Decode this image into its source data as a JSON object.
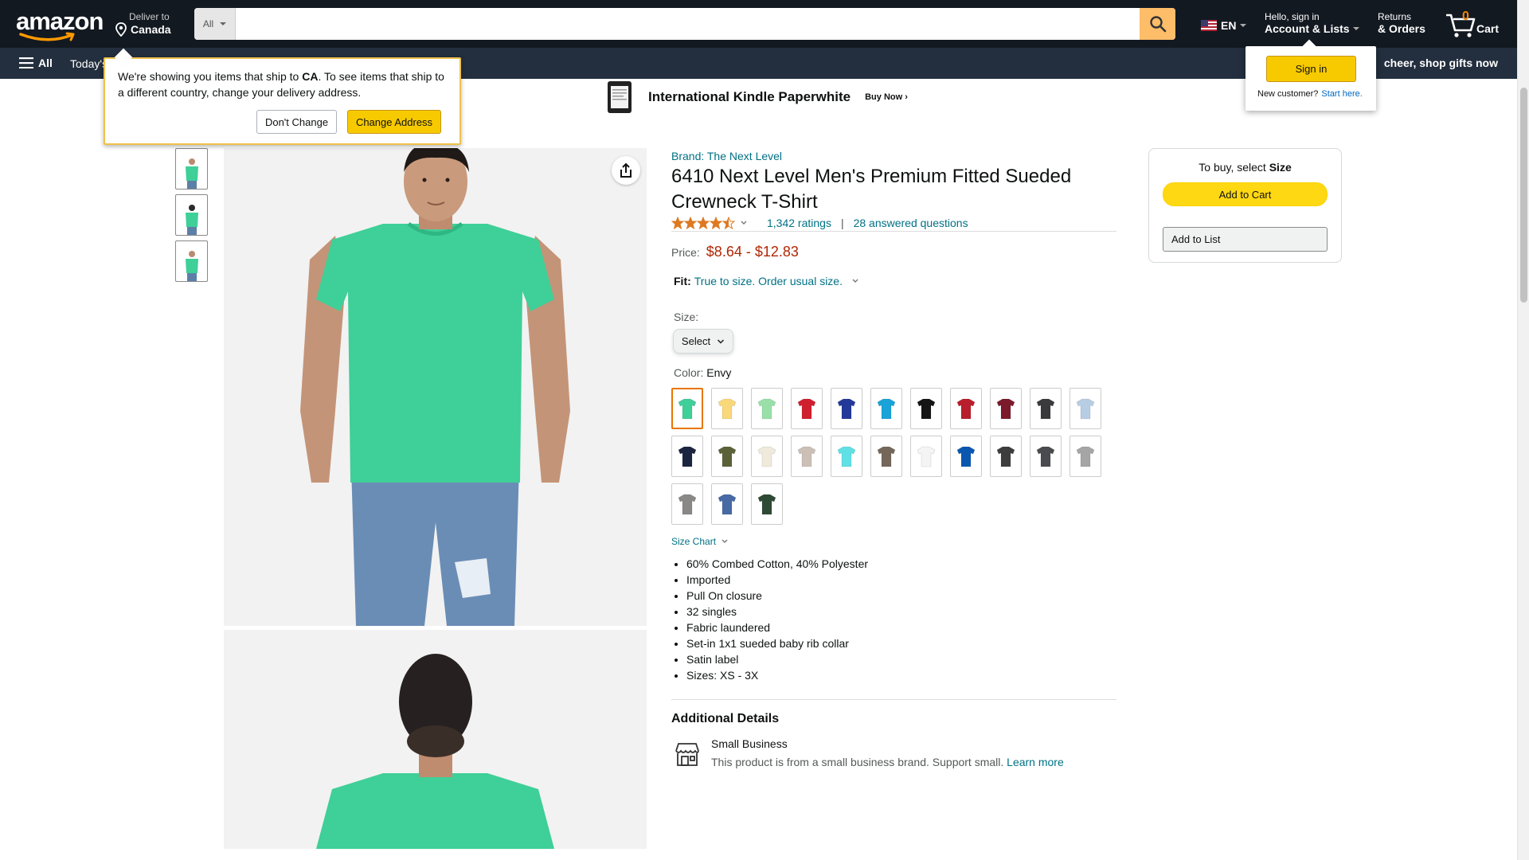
{
  "header": {
    "logo_text": "amazon",
    "deliver_line1": "Deliver to",
    "deliver_line2": "Canada",
    "search_category": "All",
    "search_placeholder": "",
    "lang": "EN",
    "account_line1": "Hello, sign in",
    "account_line2": "Account & Lists",
    "returns_line1": "Returns",
    "returns_line2": "& Orders",
    "cart_count": "0",
    "cart_label": "Cart"
  },
  "subnav": {
    "all_label": "All",
    "today_label": "Today's",
    "promo": "cheer, shop gifts now"
  },
  "banner": {
    "title": "International Kindle Paperwhite",
    "cta": "Buy Now ›"
  },
  "ship_popover": {
    "text_before": "We're showing you items that ship to ",
    "country": "CA",
    "text_after": ". To see items that ship to a different country, change your delivery address.",
    "dont_change": "Don't Change",
    "change_address": "Change Address"
  },
  "signin_popover": {
    "button": "Sign in",
    "new_customer": "New customer?",
    "start_here": "Start here."
  },
  "product": {
    "brand": "Brand: The Next Level",
    "title": "6410 Next Level Men's Premium Fitted Sueded Crewneck T-Shirt",
    "rating": 4.5,
    "ratings_count": "1,342 ratings",
    "questions": "28 answered questions",
    "price_label": "Price:",
    "price": "$8.64 - $12.83",
    "fit_label": "Fit:",
    "fit_value": "True to size. Order usual size.",
    "size_label": "Size:",
    "size_select": "Select",
    "color_label": "Color: ",
    "color_value": "Envy",
    "size_chart": "Size Chart",
    "bullets": [
      "60% Combed Cotton, 40% Polyester",
      "Imported",
      "Pull On closure",
      "32 singles",
      "Fabric laundered",
      "Set-in 1x1 sueded baby rib collar",
      "Satin label",
      "Sizes: XS - 3X"
    ],
    "additional_title": "Additional Details",
    "small_business_title": "Small Business",
    "small_business_desc": "This product is from a small business brand. Support small.",
    "learn_more": "Learn more"
  },
  "swatches": [
    {
      "name": "Envy",
      "color": "#3fcf98",
      "selected": true
    },
    {
      "name": "banana",
      "color": "#f9d87a"
    },
    {
      "name": "mint",
      "color": "#98e0a8"
    },
    {
      "name": "red",
      "color": "#d0202e"
    },
    {
      "name": "royal",
      "color": "#23399a"
    },
    {
      "name": "turquoise",
      "color": "#1aa3d8"
    },
    {
      "name": "black",
      "color": "#151515"
    },
    {
      "name": "cardinal",
      "color": "#b81e2c"
    },
    {
      "name": "maroon",
      "color": "#7a1a2a"
    },
    {
      "name": "charcoal",
      "color": "#3a3a3d"
    },
    {
      "name": "light blue",
      "color": "#b7cde4"
    },
    {
      "name": "navy",
      "color": "#1c2540"
    },
    {
      "name": "military green",
      "color": "#5b6238"
    },
    {
      "name": "natural",
      "color": "#efeadb"
    },
    {
      "name": "sand",
      "color": "#cbbfb6"
    },
    {
      "name": "aqua",
      "color": "#5fe0e5"
    },
    {
      "name": "warm gray",
      "color": "#74675a"
    },
    {
      "name": "white",
      "color": "#f4f4f4"
    },
    {
      "name": "royal blue",
      "color": "#0b57b0"
    },
    {
      "name": "dark heather",
      "color": "#3d3d3d"
    },
    {
      "name": "heavy metal",
      "color": "#4a4b4e"
    },
    {
      "name": "heather gray",
      "color": "#a5a5a5"
    },
    {
      "name": "gray",
      "color": "#8a8787"
    },
    {
      "name": "denim",
      "color": "#476aa5"
    },
    {
      "name": "forest",
      "color": "#2f4a34"
    }
  ],
  "buybox": {
    "text": "To buy, select ",
    "text_bold": "Size",
    "add_to_cart": "Add to Cart",
    "add_to_list": "Add to List"
  },
  "colors": {
    "nav_bg": "#131921",
    "subnav_bg": "#232f3e",
    "search_btn": "#febd69",
    "accent_yellow": "#ffd814",
    "link": "#007185",
    "price": "#b12704",
    "shirt": "#3fcf98"
  }
}
